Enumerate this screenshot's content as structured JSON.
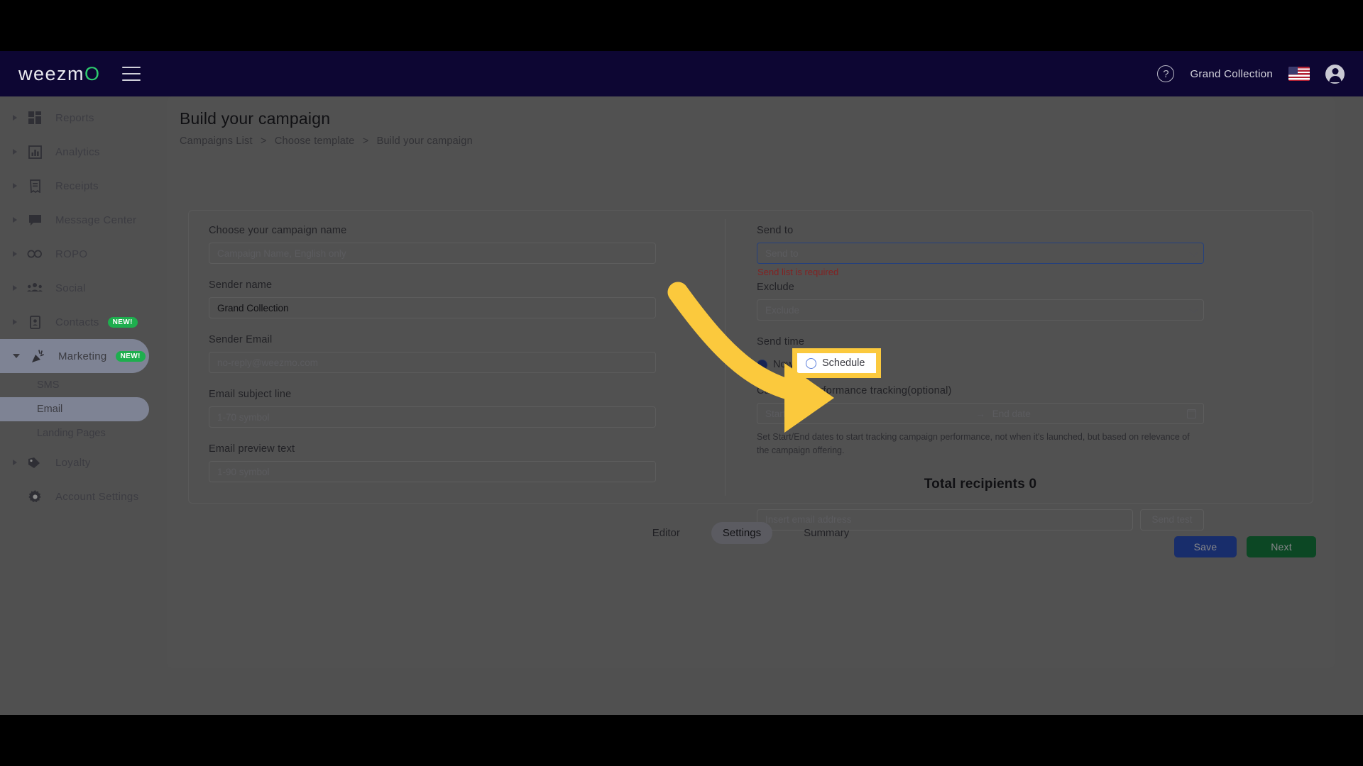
{
  "topnav": {
    "brand": "weezmo",
    "brand_prefix": "weezm",
    "brand_accent": "O",
    "menu_icon": "hamburger-icon",
    "help_icon": "?",
    "account_name": "Grand Collection",
    "flag": "us-flag",
    "avatar_icon": "account-circle-icon"
  },
  "sidebar": {
    "items": [
      {
        "label": "Reports",
        "icon": "dashboard-icon",
        "expandable": true,
        "badge": null
      },
      {
        "label": "Analytics",
        "icon": "bar-chart-icon",
        "expandable": true,
        "badge": null
      },
      {
        "label": "Receipts",
        "icon": "receipt-icon",
        "expandable": true,
        "badge": null
      },
      {
        "label": "Message Center",
        "icon": "chat-bubble-icon",
        "expandable": true,
        "badge": null
      },
      {
        "label": "ROPO",
        "icon": "infinity-icon",
        "expandable": true,
        "badge": null
      },
      {
        "label": "Social",
        "icon": "people-icon",
        "expandable": true,
        "badge": null
      },
      {
        "label": "Contacts",
        "icon": "contact-card-icon",
        "expandable": true,
        "badge": "NEW!"
      },
      {
        "label": "Marketing",
        "icon": "megaphone-icon",
        "expandable": true,
        "expanded": true,
        "badge": "NEW!"
      }
    ],
    "marketing_children": [
      {
        "label": "SMS",
        "selected": false
      },
      {
        "label": "Email",
        "selected": true
      },
      {
        "label": "Landing Pages",
        "selected": false
      }
    ],
    "tail_items": [
      {
        "label": "Loyalty",
        "icon": "tag-icon",
        "expandable": true,
        "badge": null
      },
      {
        "label": "Account Settings",
        "icon": "gear-icon",
        "expandable": false,
        "badge": null
      }
    ]
  },
  "page": {
    "title": "Build your campaign",
    "breadcrumb": [
      "Campaigns List",
      "Choose template",
      "Build your campaign"
    ],
    "breadcrumb_separator": ">"
  },
  "form_left": {
    "campaign_name": {
      "label": "Choose your campaign name",
      "placeholder": "Campaign Name, English only",
      "value": ""
    },
    "sender_name": {
      "label": "Sender name",
      "placeholder": "",
      "value": "Grand Collection"
    },
    "sender_email": {
      "label": "Sender Email",
      "placeholder": "no-reply@weezmo.com",
      "value": ""
    },
    "subject_line": {
      "label": "Email subject line",
      "placeholder": "1-70 symbol",
      "value": ""
    },
    "preview_text": {
      "label": "Email preview text",
      "placeholder": "1-90 symbol",
      "value": ""
    }
  },
  "form_right": {
    "send_to": {
      "label": "Send to",
      "placeholder": "Send to",
      "value": "",
      "error": "Send list is required",
      "error_color": "#e03b3b",
      "focus_color": "#3f6fd8"
    },
    "exclude": {
      "label": "Exclude",
      "placeholder": "Exclude",
      "value": ""
    },
    "send_time": {
      "label": "Send time",
      "options": [
        {
          "label": "Now",
          "selected": true
        },
        {
          "label": "Schedule",
          "selected": false
        }
      ],
      "highlight_color": "#fbc93d"
    },
    "tracking": {
      "label": "Campaign performance tracking(optional)",
      "start_placeholder": "Start date",
      "end_placeholder": "End date",
      "range_arrow": "→",
      "calendar_icon": "calendar-icon",
      "hint": "Set Start/End dates to start tracking campaign performance, not when it's launched, but based on relevance of the campaign offering."
    },
    "total_recipients": "Total recipients 0",
    "send_test": {
      "placeholder": "Insert email address",
      "button_label": "Send test"
    }
  },
  "tabs": [
    {
      "label": "Editor",
      "active": false
    },
    {
      "label": "Settings",
      "active": true
    },
    {
      "label": "Summary",
      "active": false
    }
  ],
  "footer": {
    "save_label": "Save",
    "save_color": "#2a4fb8",
    "next_label": "Next",
    "next_color": "#167a3f"
  }
}
